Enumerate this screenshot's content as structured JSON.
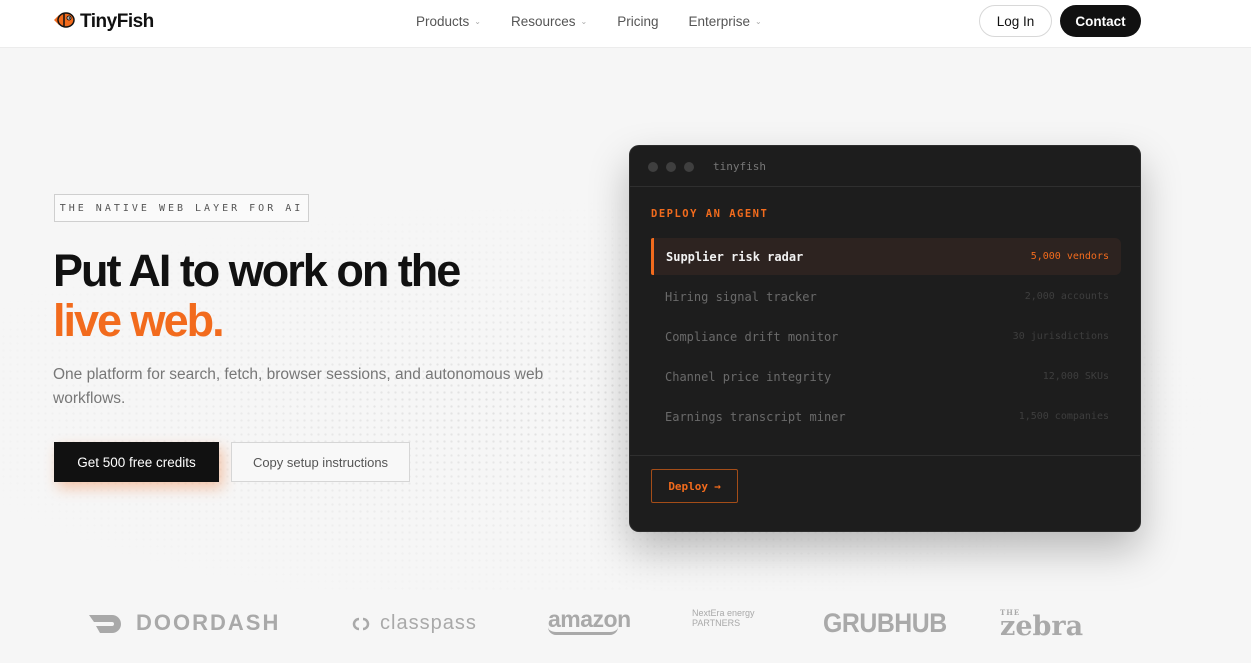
{
  "nav": {
    "brand": "TinyFish",
    "links": [
      {
        "label": "Products",
        "has_menu": true
      },
      {
        "label": "Resources",
        "has_menu": true
      },
      {
        "label": "Pricing",
        "has_menu": false
      },
      {
        "label": "Enterprise",
        "has_menu": true
      }
    ],
    "login_label": "Log In",
    "contact_label": "Contact"
  },
  "hero": {
    "eyebrow": "THE NATIVE WEB LAYER FOR AI",
    "headline": "Put AI to work on the",
    "headline_accent": "live web.",
    "subtitle": "One platform for search, fetch, browser sessions, and autonomous web workflows.",
    "primary_cta": "Get 500 free credits",
    "secondary_cta": "Copy setup instructions"
  },
  "terminal": {
    "title": "tinyfish",
    "section_label": "DEPLOY AN AGENT",
    "items": [
      {
        "name": "Supplier risk radar",
        "meta": "5,000 vendors",
        "active": true
      },
      {
        "name": "Hiring signal tracker",
        "meta": "2,000 accounts",
        "active": false
      },
      {
        "name": "Compliance drift monitor",
        "meta": "30 jurisdictions",
        "active": false
      },
      {
        "name": "Channel price integrity",
        "meta": "12,000 SKUs",
        "active": false
      },
      {
        "name": "Earnings transcript miner",
        "meta": "1,500 companies",
        "active": false
      }
    ],
    "deploy_label": "Deploy",
    "deploy_arrow": "→"
  },
  "logos": {
    "doordash": "DOORDASH",
    "classpass": "classpass",
    "amazon": "amazon",
    "nextera_line1": "NextEra energy",
    "nextera_line2": "PARTNERS",
    "grubhub": "GRUBHUB",
    "zebra_the": "THE",
    "zebra": "zebra"
  },
  "colors": {
    "accent": "#f26b1d",
    "dark": "#111111",
    "terminal_bg": "#1d1d1d"
  }
}
